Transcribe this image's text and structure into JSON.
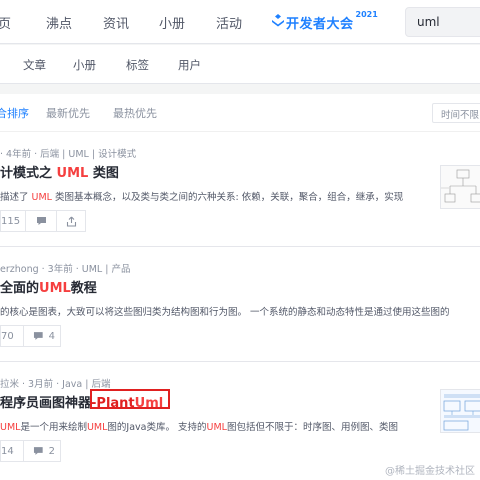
{
  "topnav": {
    "items": [
      "页",
      "沸点",
      "资讯",
      "小册",
      "活动"
    ],
    "event_logo": {
      "text": "开发者大会",
      "year": "2021",
      "icon": "juejin-logo-icon"
    },
    "search": {
      "value": "uml"
    }
  },
  "subnav": {
    "items": [
      "文章",
      "小册",
      "标签",
      "用户"
    ]
  },
  "sort": {
    "items": [
      "合排序",
      "最新优先",
      "最热优先"
    ],
    "active": "合排序",
    "time_filter": "时间不限"
  },
  "articles": [
    {
      "meta": "· 4年前 · 后端 | UML | 设计模式",
      "title_parts": [
        "计模式之 ",
        "UML",
        " 类图"
      ],
      "abstract_parts": [
        "描述了 ",
        "UML",
        " 类图基本概念，以及类与类之间的六种关系: 依赖，关联，聚合，组合，继承，实现"
      ],
      "likes": "115",
      "comments": "",
      "has_thumbnail": true
    },
    {
      "meta": "erzhong · 3年前 · UML | 产品",
      "title_parts": [
        "全面的",
        "UML",
        "教程"
      ],
      "abstract_parts": [
        " 的核心是图表，大致可以将这些图归类为结构图和行为图。 一个系统的静态和动态特性是通过使用这些图的"
      ],
      "likes": "70",
      "comments": "4",
      "has_thumbnail": false
    },
    {
      "meta": "拉米 · 3月前 · Java | 后端",
      "title_parts": [
        "程序员画图神器",
        "-Plant",
        "Uml"
      ],
      "abstract_parts": [
        "UML",
        "是一个用来绘制",
        "UML",
        "图的Java类库。 支持的",
        "UML",
        "图包括但不限于：时序图、用例图、类图"
      ],
      "likes": "14",
      "comments": "2",
      "has_thumbnail": true
    }
  ],
  "watermark": "@稀土掘金技术社区",
  "colors": {
    "accent": "#1e80ff",
    "highlight": "#f53f3f",
    "annotation_box": "#e02020"
  }
}
